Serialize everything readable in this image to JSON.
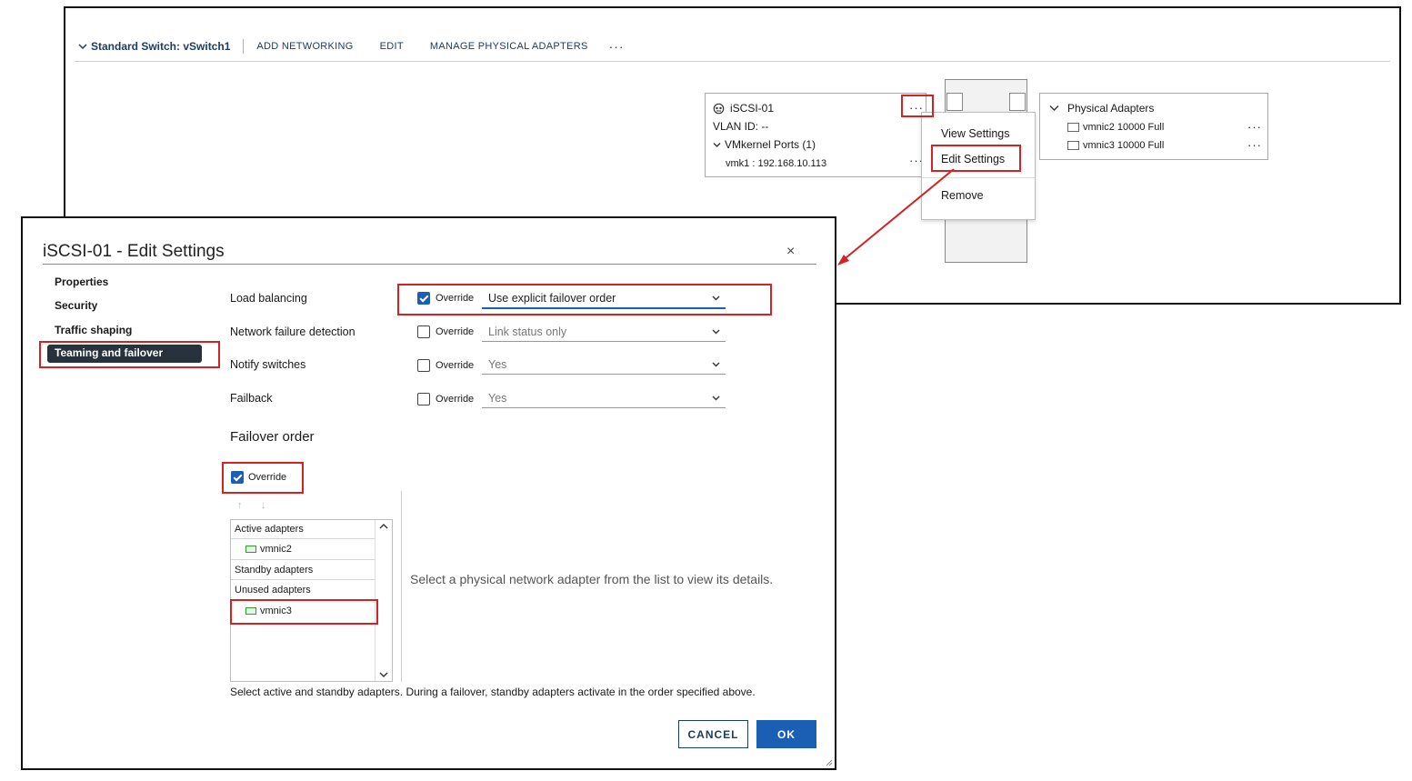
{
  "vswitch": {
    "title": "Standard Switch: vSwitch1",
    "actions": {
      "add_networking": "ADD NETWORKING",
      "edit": "EDIT",
      "manage_adapters": "MANAGE PHYSICAL ADAPTERS",
      "more": "···"
    },
    "port_group": {
      "name": "iSCSI-01",
      "vlan": "VLAN ID: --",
      "vmkernel_ports": "VMkernel Ports (1)",
      "vmk": "vmk1 : 192.168.10.113",
      "more": "···",
      "row_more": "···"
    },
    "physical_adapters": {
      "title": "Physical Adapters",
      "items": [
        {
          "label": "vmnic2 10000 Full",
          "more": "···"
        },
        {
          "label": "vmnic3 10000 Full",
          "more": "···"
        }
      ]
    },
    "context_menu": {
      "items": [
        "View Settings",
        "Edit Settings",
        "Remove"
      ]
    }
  },
  "dialog": {
    "title": "iSCSI-01 - Edit Settings",
    "close": "×",
    "nav": [
      "Properties",
      "Security",
      "Traffic shaping",
      "Teaming and failover"
    ],
    "settings": [
      {
        "label": "Load balancing",
        "override": "Override",
        "override_checked": true,
        "value": "Use explicit failover order",
        "enabled": true
      },
      {
        "label": "Network failure detection",
        "override": "Override",
        "override_checked": false,
        "value": "Link status only",
        "enabled": false
      },
      {
        "label": "Notify switches",
        "override": "Override",
        "override_checked": false,
        "value": "Yes",
        "enabled": false
      },
      {
        "label": "Failback",
        "override": "Override",
        "override_checked": false,
        "value": "Yes",
        "enabled": false
      }
    ],
    "failover": {
      "title": "Failover order",
      "override": "Override",
      "override_checked": true,
      "move_up": "↑",
      "move_down": "↓",
      "groups": {
        "active": {
          "label": "Active adapters",
          "items": [
            "vmnic2"
          ]
        },
        "standby": {
          "label": "Standby adapters",
          "items": []
        },
        "unused": {
          "label": "Unused adapters",
          "items": [
            "vmnic3"
          ]
        }
      },
      "detail_message": "Select a physical network adapter from the list to view its details.",
      "footnote": "Select active and standby adapters. During a failover, standby adapters activate in the order specified above."
    },
    "buttons": {
      "cancel": "CANCEL",
      "ok": "OK"
    }
  },
  "colors": {
    "accent": "#1b5fb4",
    "nav_active_bg": "#27323c",
    "highlight": "#d42323",
    "link": "#1d3c60"
  }
}
